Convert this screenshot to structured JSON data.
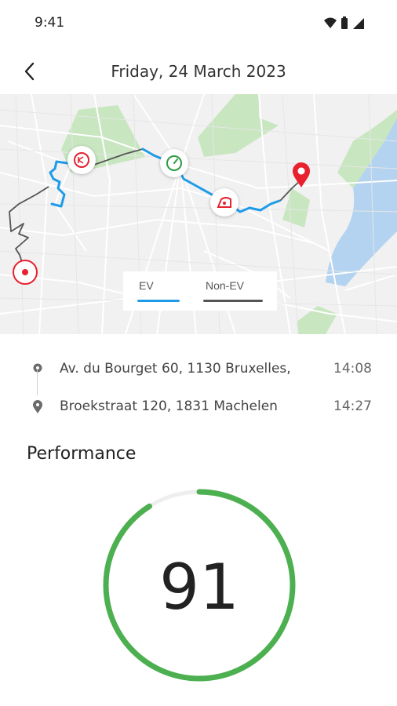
{
  "status_bar": {
    "time": "9:41"
  },
  "header": {
    "title": "Friday, 24 March 2023"
  },
  "map": {
    "legend": {
      "ev_label": "EV",
      "non_ev_label": "Non-EV"
    },
    "colors": {
      "ev": "#1e9be8",
      "non_ev": "#555555",
      "start_pin": "#e8212f",
      "end_pin": "#e8212f",
      "accel_marker": "#e8212f",
      "speed_marker": "#2e9c44"
    },
    "icons": [
      "start-pin-icon",
      "harsh-braking-icon",
      "speed-ok-icon",
      "harsh-cornering-icon",
      "end-pin-icon"
    ]
  },
  "trip": {
    "start": {
      "address": "Av. du Bourget 60, 1130 Bruxelles,",
      "time": "14:08"
    },
    "end": {
      "address": "Broekstraat 120, 1831 Machelen",
      "time": "14:27"
    }
  },
  "performance": {
    "title": "Performance",
    "score": "91",
    "score_fraction": 0.91,
    "colors": {
      "arc": "#4caf50",
      "track": "#eeeeee"
    }
  }
}
